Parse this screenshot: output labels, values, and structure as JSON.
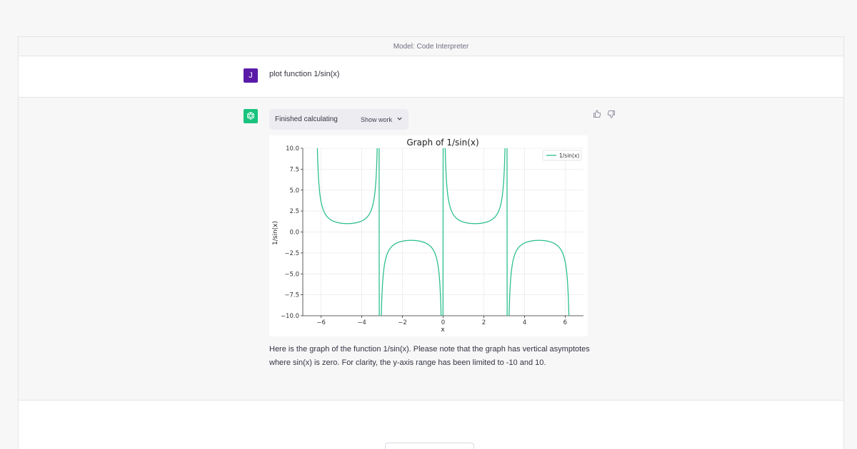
{
  "header": {
    "model_label": "Model: Code Interpreter"
  },
  "user_message": {
    "avatar_letter": "J",
    "text": "plot function 1/sin(x)"
  },
  "assistant": {
    "tool_status": "Finished calculating",
    "show_work_label": "Show work",
    "answer_text": "Here is the graph of the function 1/sin(x). Please note that the graph has vertical asymptotes where sin(x) is zero. For clarity, the y-axis range has been limited to -10 and 10."
  },
  "icons": {
    "avatar_bot": "openai-logo-icon",
    "thumbs_up": "thumbs-up-icon",
    "thumbs_down": "thumbs-down-icon",
    "show_work_chevron": "chevron-down-icon"
  },
  "colors": {
    "user_avatar": "#5a1aa8",
    "bot_avatar": "#19c37d",
    "series": "#2ec08c"
  },
  "chart_data": {
    "type": "line",
    "title": "Graph of 1/sin(x)",
    "xlabel": "x",
    "ylabel": "1/sin(x)",
    "xlim": [
      -6.9,
      6.9
    ],
    "ylim": [
      -10,
      10
    ],
    "x_ticks": [
      -6,
      -4,
      -2,
      0,
      2,
      4,
      6
    ],
    "x_tick_labels": [
      "−6",
      "−4",
      "−2",
      "0",
      "2",
      "4",
      "6"
    ],
    "y_ticks": [
      10,
      7.5,
      5,
      2.5,
      0,
      -2.5,
      -5,
      -7.5,
      -10
    ],
    "y_tick_labels": [
      "10.0",
      "7.5",
      "5.0",
      "2.5",
      "0.0",
      "−2.5",
      "−5.0",
      "−7.5",
      "−10.0"
    ],
    "grid": true,
    "legend_position": "top-right",
    "series": [
      {
        "name": "1/sin(x)",
        "function": "1/sin(x)",
        "x_range": [
          -6.283,
          6.283
        ]
      }
    ]
  }
}
